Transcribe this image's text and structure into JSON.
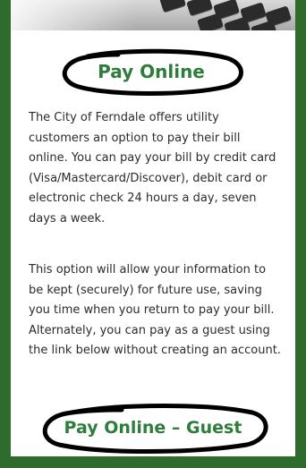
{
  "section": {
    "title": "Pay Online",
    "paragraph_1": "The City of Ferndale offers utility customers an option to pay their bill online. You can pay your bill by credit card (Visa/Mastercard/Discover), debit card or electronic check 24 hours a day, seven days a week.",
    "paragraph_2": "This option will allow your information to be kept (securely) for future use, saving you time when you return to pay your bill. Alternately, you can pay as a guest using the link below without creating an account.",
    "guest_link": "Pay Online – Guest"
  },
  "colors": {
    "frame": "#2f6b2c",
    "accent_text": "#2e7d3b",
    "body_text": "#2b2b2b",
    "annotation_ink": "#000000"
  },
  "icons": {
    "hero": "keyboard-photo"
  }
}
